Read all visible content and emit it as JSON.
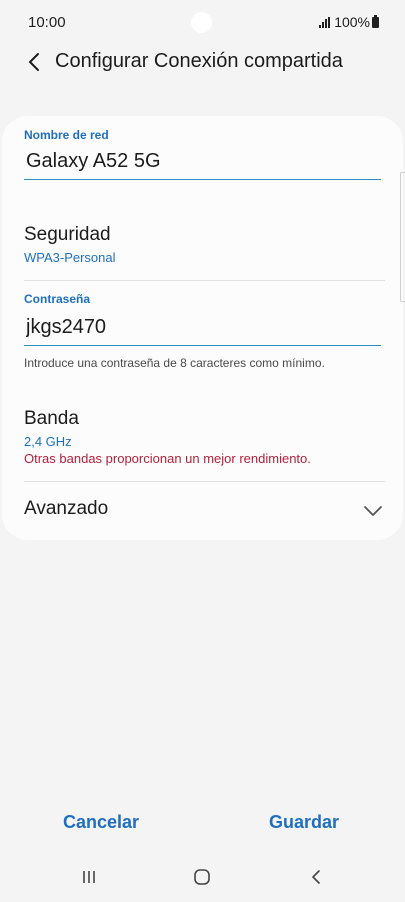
{
  "status_bar": {
    "time": "10:00",
    "battery": "100%"
  },
  "header": {
    "title": "Configurar Conexión compartida"
  },
  "network_name": {
    "label": "Nombre de red",
    "value": "Galaxy A52 5G"
  },
  "security": {
    "title": "Seguridad",
    "value": "WPA3-Personal"
  },
  "password": {
    "label": "Contraseña",
    "value": "jkgs2470",
    "helper": "Introduce una contraseña de 8 caracteres como mínimo."
  },
  "band": {
    "title": "Banda",
    "value": "2,4 GHz",
    "warning": "Otras bandas proporcionan un mejor rendimiento."
  },
  "advanced": {
    "title": "Avanzado"
  },
  "actions": {
    "cancel_label": "Cancelar",
    "save_label": "Guardar"
  },
  "icons": {
    "back": "back-arrow-icon",
    "expand": "chevron-down-icon",
    "nav_recents": "recents-icon",
    "nav_home": "home-icon",
    "nav_back": "nav-back-icon"
  },
  "colors": {
    "accent": "#1f6fbf",
    "warning": "#b3213b",
    "background": "#f4f4f4",
    "card": "#fcfcfc"
  }
}
